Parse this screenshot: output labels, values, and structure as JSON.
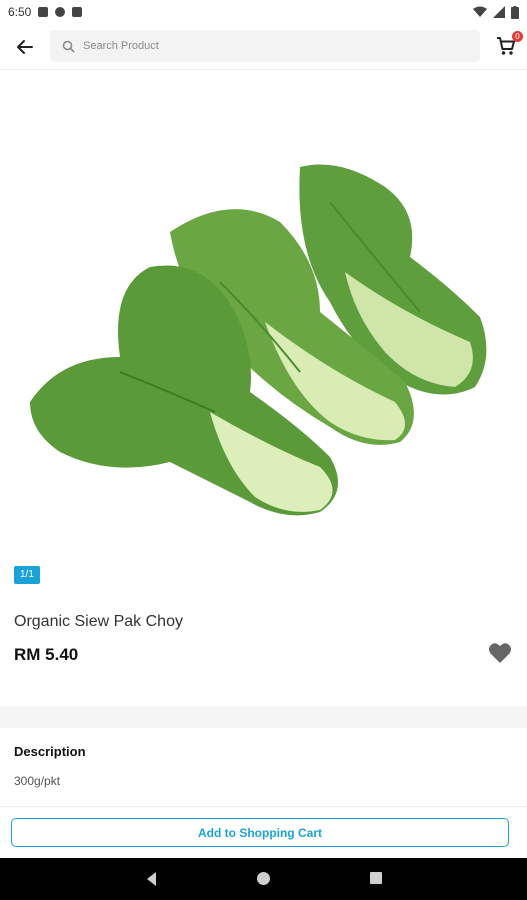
{
  "status_bar": {
    "time": "6:50"
  },
  "header": {
    "search": {
      "placeholder": "Search Product"
    },
    "cart": {
      "badge": "0"
    }
  },
  "product": {
    "image_alt": "Organic Siew Pak Choy",
    "pager": "1/1",
    "name": "Organic Siew Pak Choy",
    "price": "RM 5.40"
  },
  "description": {
    "title": "Description",
    "text": "300g/pkt"
  },
  "actions": {
    "add_to_cart": "Add to Shopping Cart"
  },
  "colors": {
    "accent": "#1aa3d6",
    "badge": "#e53935",
    "favorite": "#666666"
  }
}
